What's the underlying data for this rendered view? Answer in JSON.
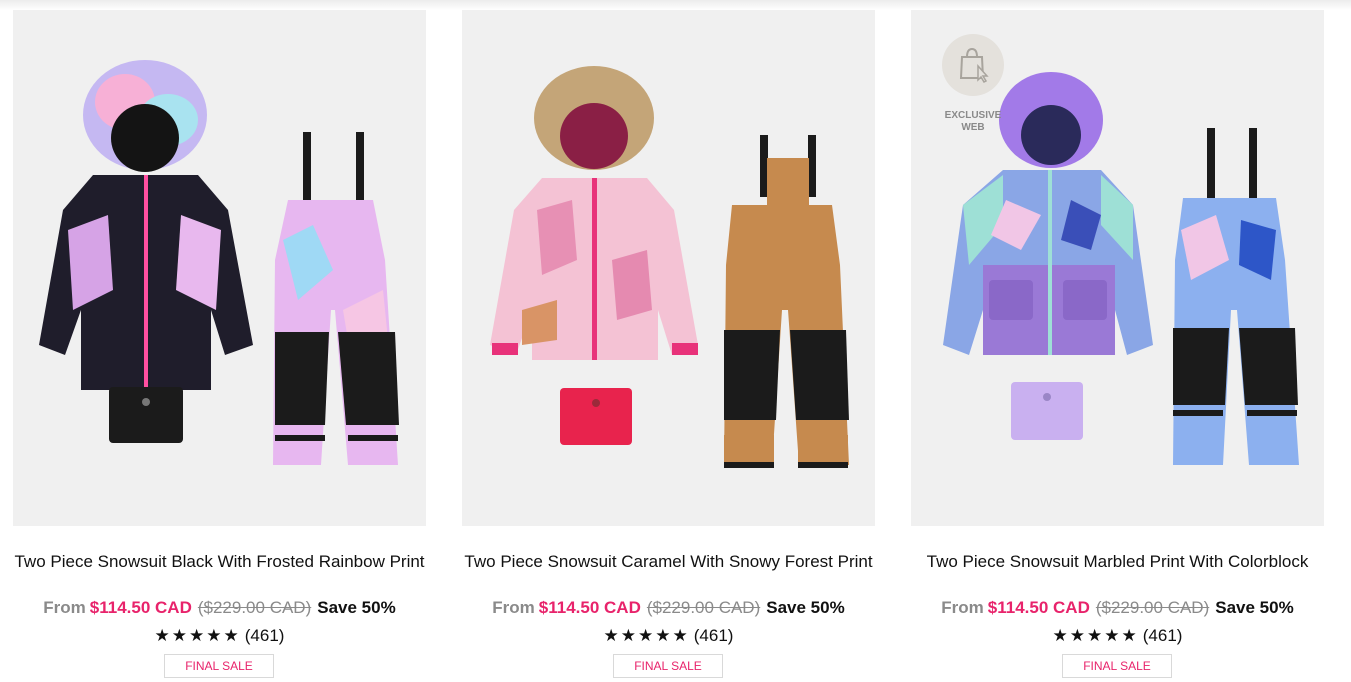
{
  "products": [
    {
      "title": "Two Piece Snowsuit Black With Frosted Rainbow Print",
      "from_label": "From",
      "sale_price": "$114.50 CAD",
      "original_price": "($229.00 CAD)",
      "save": "Save 50%",
      "stars": "★★★★★",
      "rating_count": "(461)",
      "badge": "FINAL SALE",
      "colors": {
        "jacket": "#1f1d2b",
        "panel": "#d6a3e6",
        "hood": "#b9c8f5",
        "pants_top": "#e7b7f0",
        "pants_knee": "#1b1b1b",
        "neck": "#1b1b1b",
        "zip": "#ff4fa0"
      }
    },
    {
      "title": "Two Piece Snowsuit Caramel With Snowy Forest Print",
      "from_label": "From",
      "sale_price": "$114.50 CAD",
      "original_price": "($229.00 CAD)",
      "save": "Save 50%",
      "stars": "★★★★★",
      "rating_count": "(461)",
      "badge": "FINAL SALE",
      "colors": {
        "jacket": "#f4c2d4",
        "panel": "#f4c2d4",
        "hood": "#b99a6a",
        "pants_top": "#c68a4e",
        "pants_knee": "#1b1b1b",
        "neck": "#e8234d",
        "zip": "#e8327a"
      }
    },
    {
      "title": "Two Piece Snowsuit Marbled Print With Colorblock",
      "from_label": "From",
      "sale_price": "$114.50 CAD",
      "original_price": "($229.00 CAD)",
      "save": "Save 50%",
      "stars": "★★★★★",
      "rating_count": "(461)",
      "badge": "FINAL SALE",
      "exclusive_label": "EXCLUSIVE WEB",
      "colors": {
        "jacket": "#8aa6e6",
        "panel": "#9a79d6",
        "hood": "#a27ae8",
        "pants_top": "#8cb0ef",
        "pants_knee": "#1b1b1b",
        "neck": "#c9b0f0",
        "zip": "#9ee0d6"
      }
    }
  ]
}
